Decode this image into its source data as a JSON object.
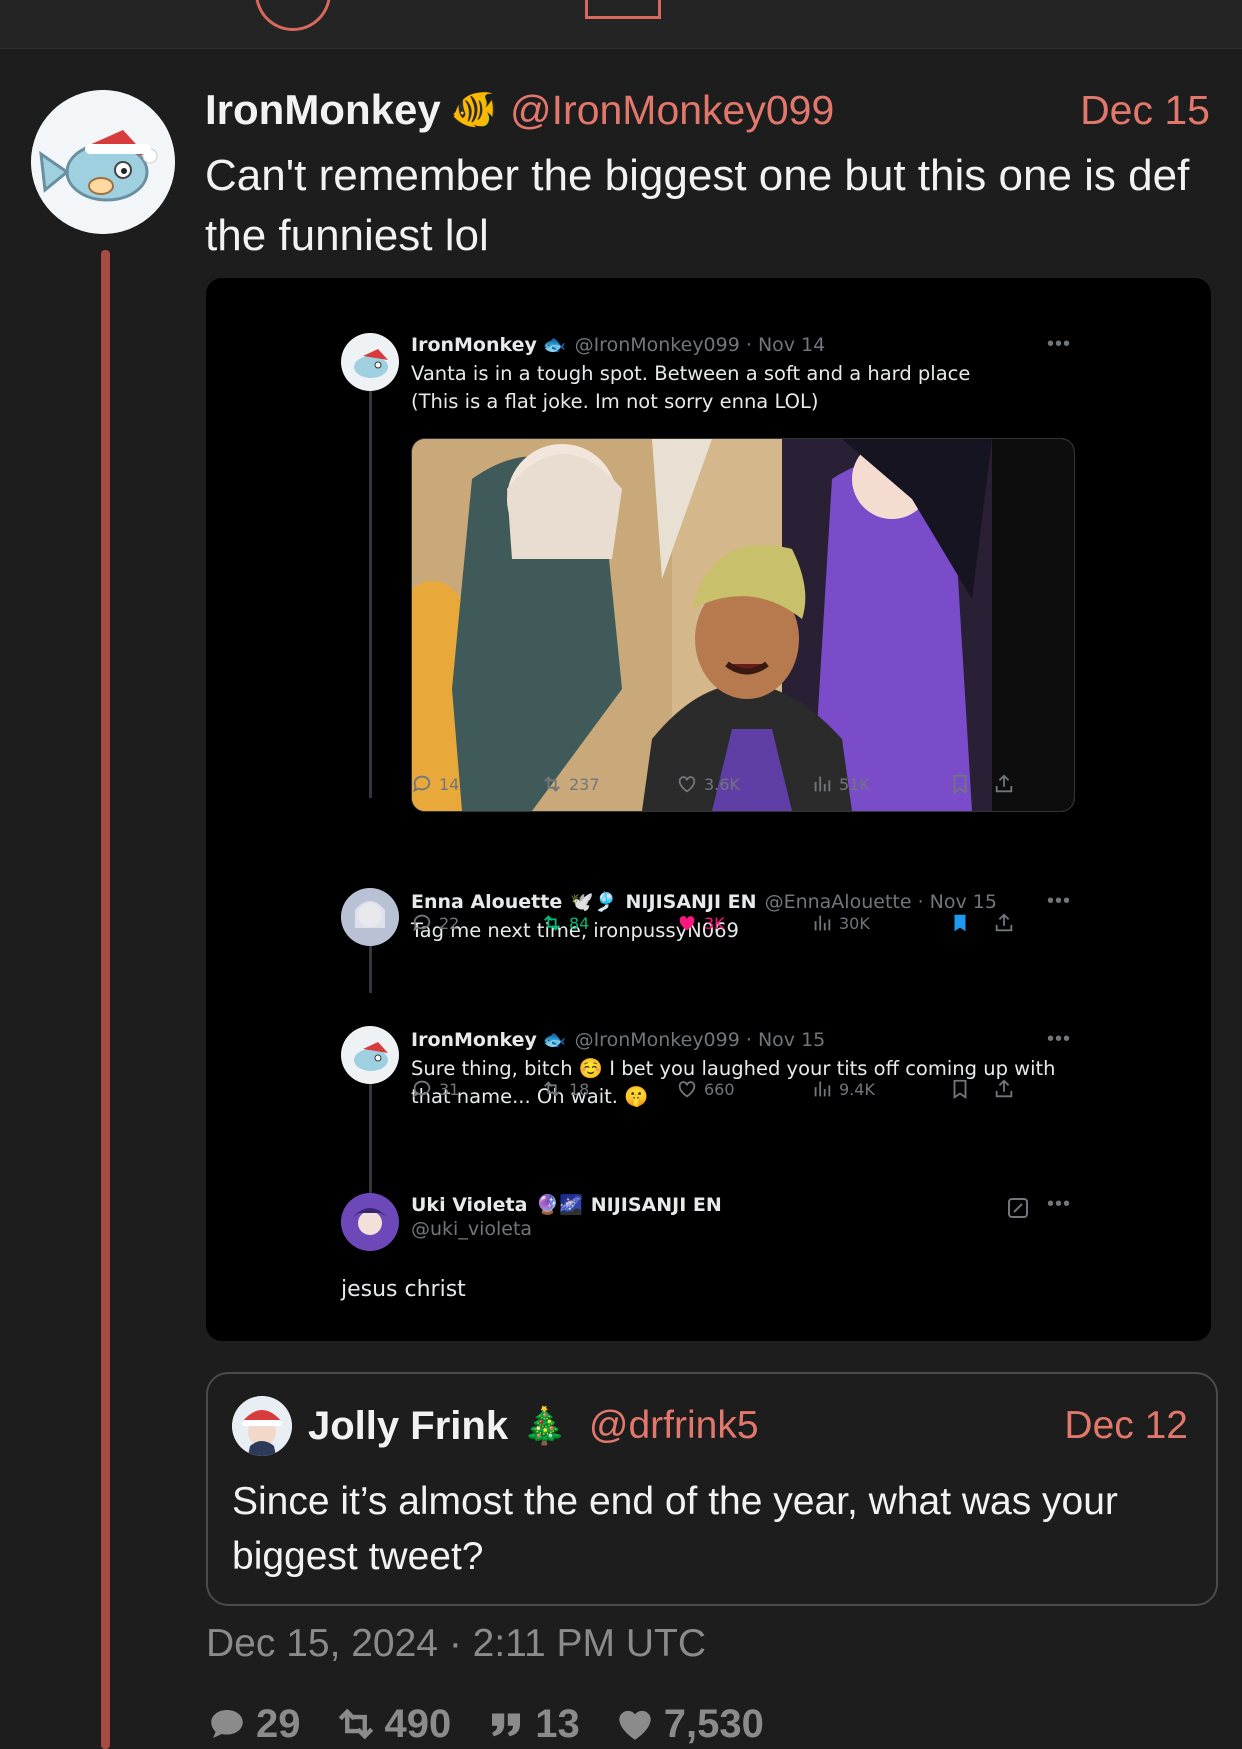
{
  "post": {
    "author": "IronMonkey",
    "author_emoji": "🐠",
    "handle": "@IronMonkey099",
    "date": "Dec 15",
    "text": "Can't remember the biggest one but this one is def the funniest lol",
    "timestamp": "Dec 15, 2024 · 2:11 PM UTC",
    "stats": {
      "replies": "29",
      "reposts": "490",
      "quotes": "13",
      "likes": "7,530"
    }
  },
  "embed": {
    "tweet1": {
      "name": "IronMonkey",
      "meta": "@IronMonkey099 · Nov 14",
      "line1": "Vanta is in a tough spot. Between a soft and a hard place",
      "line2": "(This is a flat joke. Im not sorry enna LOL)",
      "stats": {
        "replies": "14",
        "reposts": "237",
        "likes": "3.6K",
        "views": "51K"
      }
    },
    "tweet2": {
      "name": "Enna Alouette",
      "affiliation": "NIJISANJI EN",
      "meta": "@EnnaAlouette · Nov 15",
      "text": "Tag me next time, ironpussyN069",
      "stats": {
        "replies": "22",
        "reposts": "84",
        "likes": "3K",
        "views": "30K"
      }
    },
    "tweet3": {
      "name": "IronMonkey",
      "meta": "@IronMonkey099 · Nov 15",
      "line1a": "Sure thing, bitch",
      "line1b": "I bet you laughed your tits off coming up with",
      "line2": "that name... Oh wait.",
      "stats": {
        "replies": "31",
        "reposts": "18",
        "likes": "660",
        "views": "9.4K"
      }
    },
    "tweet4": {
      "name": "Uki Violeta",
      "affiliation": "NIJISANJI EN",
      "handle": "@uki_violeta",
      "text": "jesus christ"
    }
  },
  "quoted": {
    "name": "Jolly Frink",
    "emoji": "🎄",
    "handle": "@drfrink5",
    "date": "Dec 12",
    "text": "Since it’s almost the end of the year, what was your biggest tweet?"
  },
  "colors": {
    "accent": "#e2776c",
    "thread_line": "#a84b44",
    "background": "#1d1d1d",
    "like_pink": "#f91880",
    "repost_green": "#00ba7c",
    "bookmark_blue": "#1d9bf0"
  }
}
